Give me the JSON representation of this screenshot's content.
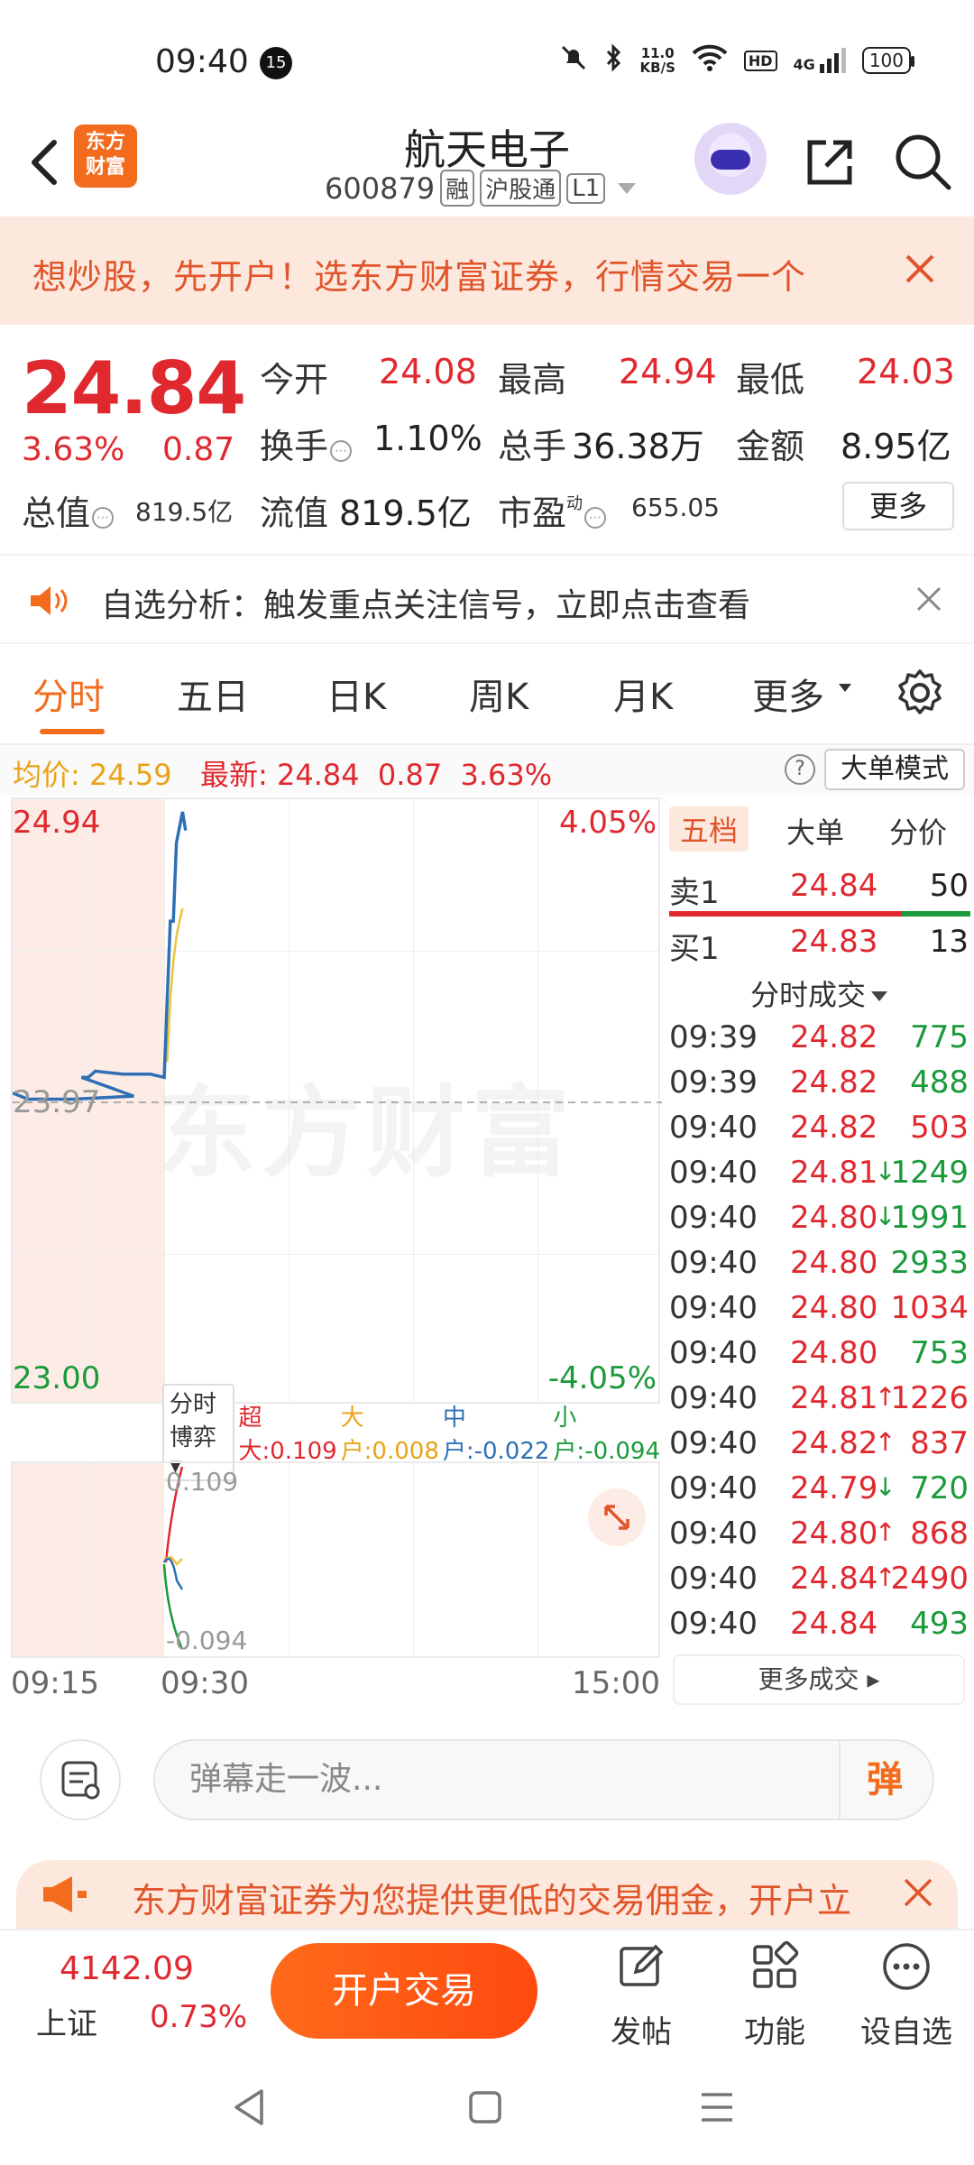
{
  "status_bar": {
    "time": "09:40",
    "notification_count": "15",
    "net_speed_top": "11.0",
    "net_speed_bottom": "KB/S",
    "hd": "HD",
    "signal": "4G",
    "battery": "100"
  },
  "header": {
    "logo_line1": "东方",
    "logo_line2": "财富",
    "stock_name": "航天电子",
    "stock_code": "600879",
    "tags": [
      "融",
      "沪股通",
      "L1"
    ]
  },
  "promo_banner": {
    "text": "想炒股，先开户！选东方财富证券，行情交易一个"
  },
  "quote": {
    "price": "24.84",
    "change_pct": "3.63%",
    "change": "0.87",
    "open_label": "今开",
    "open": "24.08",
    "high_label": "最高",
    "high": "24.94",
    "low_label": "最低",
    "low": "24.03",
    "turnover_label": "换手",
    "turnover": "1.10%",
    "volume_label": "总手",
    "volume": "36.38万",
    "amount_label": "金额",
    "amount": "8.95亿",
    "mktcap_label": "总值",
    "mktcap": "819.5亿",
    "float_label": "流值",
    "float": "819.5亿",
    "pe_label": "市盈",
    "pe_sup": "动",
    "pe": "655.05",
    "more_label": "更多"
  },
  "analysis_bar": {
    "text": "自选分析：触发重点关注信号，立即点击查看"
  },
  "tabs": [
    {
      "label": "分时",
      "active": true
    },
    {
      "label": "五日"
    },
    {
      "label": "日K"
    },
    {
      "label": "周K"
    },
    {
      "label": "月K"
    },
    {
      "label": "更多"
    }
  ],
  "avg_bar": {
    "avg_label": "均价:",
    "avg_value": "24.59",
    "latest_label": "最新:",
    "latest_value": "24.84",
    "latest_change": "0.87",
    "latest_pct": "3.63%",
    "help": "?",
    "big_order_mode": "大单模式"
  },
  "chart_data": {
    "type": "line",
    "y_top": "24.94",
    "y_mid": "23.97",
    "y_bottom": "23.00",
    "pct_top": "4.05%",
    "pct_bottom": "-4.05%",
    "watermark": "东方财富",
    "ylim": [
      23.0,
      24.94
    ],
    "price_series": [
      [
        0,
        24.0
      ],
      [
        1,
        23.98
      ],
      [
        2,
        23.98
      ],
      [
        4,
        23.98
      ],
      [
        8,
        23.99
      ],
      [
        10,
        24.05
      ],
      [
        11,
        24.05
      ],
      [
        12,
        24.07
      ],
      [
        16,
        24.06
      ],
      [
        20,
        24.06
      ],
      [
        22,
        24.05
      ],
      [
        23,
        24.3
      ],
      [
        24,
        24.55
      ],
      [
        25,
        24.55
      ],
      [
        26,
        24.8
      ],
      [
        27,
        24.85
      ],
      [
        28,
        24.9
      ],
      [
        29,
        24.84
      ]
    ],
    "avg_series": [
      [
        23,
        24.1
      ],
      [
        24,
        24.3
      ],
      [
        25,
        24.42
      ],
      [
        26,
        24.5
      ],
      [
        27,
        24.55
      ],
      [
        28,
        24.59
      ]
    ],
    "x_max": 256,
    "time_start": "09:15",
    "time_open": "09:30",
    "time_end": "15:00"
  },
  "sub_chart": {
    "selector": "分时博弈",
    "super_label": "超大:",
    "super_val": "0.109",
    "large_label": "大户:",
    "large_val": "0.008",
    "mid_label": "中户:",
    "mid_val": "-0.022",
    "small_label": "小户:",
    "small_val": "-0.094",
    "y_top": "0.109",
    "y_bottom": "-0.094"
  },
  "order_book": {
    "tabs": [
      "五档",
      "大单",
      "分价"
    ],
    "ask": {
      "label": "卖1",
      "price": "24.84",
      "vol": "50"
    },
    "bid": {
      "label": "买1",
      "price": "24.83",
      "vol": "13"
    },
    "ticks_header": "分时成交",
    "ticks": [
      {
        "t": "09:39",
        "p": "24.82",
        "a": "",
        "v": "775",
        "c": "green"
      },
      {
        "t": "09:39",
        "p": "24.82",
        "a": "",
        "v": "488",
        "c": "green"
      },
      {
        "t": "09:40",
        "p": "24.82",
        "a": "",
        "v": "503",
        "c": "red"
      },
      {
        "t": "09:40",
        "p": "24.81",
        "a": "↓",
        "v": "1249",
        "c": "green"
      },
      {
        "t": "09:40",
        "p": "24.80",
        "a": "↓",
        "v": "1991",
        "c": "green"
      },
      {
        "t": "09:40",
        "p": "24.80",
        "a": "",
        "v": "2933",
        "c": "green"
      },
      {
        "t": "09:40",
        "p": "24.80",
        "a": "",
        "v": "1034",
        "c": "red"
      },
      {
        "t": "09:40",
        "p": "24.80",
        "a": "",
        "v": "753",
        "c": "green"
      },
      {
        "t": "09:40",
        "p": "24.81",
        "a": "↑",
        "v": "1226",
        "c": "red"
      },
      {
        "t": "09:40",
        "p": "24.82",
        "a": "↑",
        "v": "837",
        "c": "red"
      },
      {
        "t": "09:40",
        "p": "24.79",
        "a": "↓",
        "v": "720",
        "c": "green"
      },
      {
        "t": "09:40",
        "p": "24.80",
        "a": "↑",
        "v": "868",
        "c": "red"
      },
      {
        "t": "09:40",
        "p": "24.84",
        "a": "↑",
        "v": "2490",
        "c": "red"
      },
      {
        "t": "09:40",
        "p": "24.84",
        "a": "",
        "v": "493",
        "c": "green"
      }
    ],
    "more_ticks": "更多成交"
  },
  "comment_bar": {
    "placeholder": "弹幕走一波...",
    "danmu": "弹"
  },
  "bottom_promo": {
    "text": "东方财富证券为您提供更低的交易佣金，开户立"
  },
  "toolbar": {
    "index_value": "4142.09",
    "index_name": "上证",
    "index_pct": "0.73%",
    "trade_button": "开户交易",
    "post": "发帖",
    "functions": "功能",
    "watchlist": "设自选"
  },
  "colors": {
    "up": "#e0282f",
    "down": "#1a9a3a",
    "accent": "#f36b1c",
    "price_line": "#2f6fb3",
    "avg_line": "#e8c53a"
  }
}
